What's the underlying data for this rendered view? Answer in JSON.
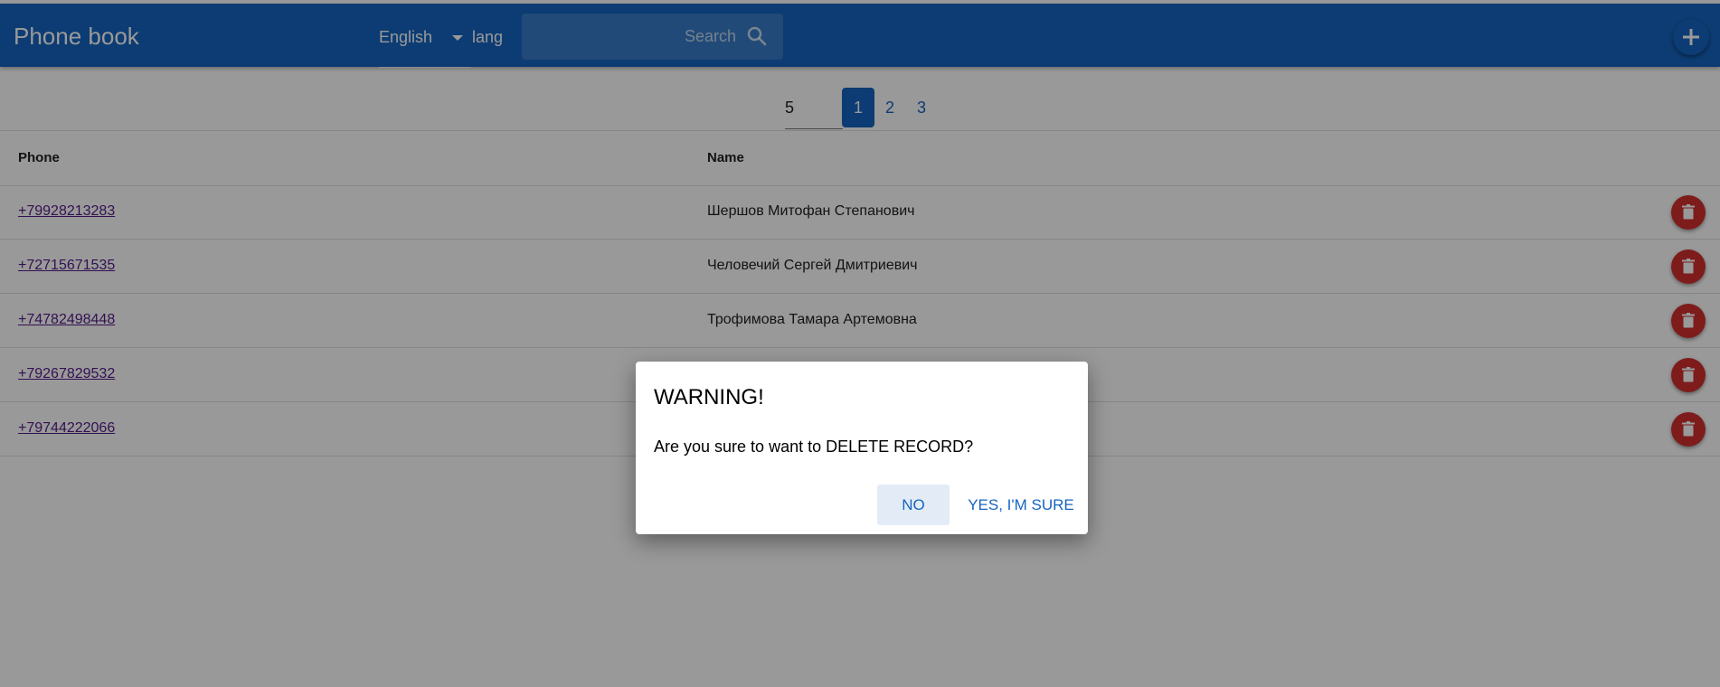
{
  "app": {
    "title": "Phone book"
  },
  "language": {
    "selected": "English",
    "label": "lang"
  },
  "search": {
    "placeholder": "Search"
  },
  "icons": {
    "search": "search-icon",
    "add": "plus-icon",
    "delete": "trash-icon",
    "dropdown": "chevron-down-icon"
  },
  "colors": {
    "primary": "#1565c0",
    "danger": "#d32f2f",
    "link": "#551a8b"
  },
  "pagination": {
    "page_size": "5",
    "pages": [
      "1",
      "2",
      "3"
    ],
    "current": "1"
  },
  "table": {
    "headers": {
      "phone": "Phone",
      "name": "Name"
    },
    "rows": [
      {
        "phone": "+79928213283",
        "name": "Шершов Митофан Степанович"
      },
      {
        "phone": "+72715671535",
        "name": "Человечий Сергей Дмитриевич"
      },
      {
        "phone": "+74782498448",
        "name": "Трофимова Тамара Артемовна"
      },
      {
        "phone": "+79267829532",
        "name": ""
      },
      {
        "phone": "+79744222066",
        "name": ""
      }
    ]
  },
  "dialog": {
    "title": "WARNING!",
    "message": "Are you sure to want to DELETE RECORD?",
    "no_label": "NO",
    "yes_label": "YES, I'M SURE"
  }
}
